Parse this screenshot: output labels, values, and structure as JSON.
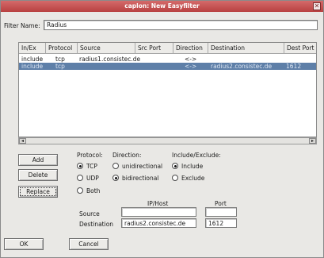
{
  "window": {
    "title": "caplon: New Easyfilter",
    "close_glyph": "✕"
  },
  "filter": {
    "label": "Filter Name:",
    "value": "Radius"
  },
  "table": {
    "headers": [
      "In/Ex",
      "Protocol",
      "Source",
      "Src Port",
      "Direction",
      "Destination",
      "Dest Port"
    ],
    "rows": [
      {
        "inex": "include",
        "protocol": "tcp",
        "source": "radius1.consistec.de",
        "src_port": "",
        "direction": "<->",
        "destination": "",
        "dest_port": ""
      },
      {
        "inex": "include",
        "protocol": "tcp",
        "source": "",
        "src_port": "",
        "direction": "<->",
        "destination": "radius2.consistec.de",
        "dest_port": "1612"
      }
    ],
    "selected_row": 1
  },
  "buttons": {
    "add": "Add",
    "delete": "Delete",
    "replace": "Replace",
    "ok": "OK",
    "cancel": "Cancel"
  },
  "protocol": {
    "label": "Protocol:",
    "options": [
      "TCP",
      "UDP",
      "Both"
    ],
    "selected": "TCP"
  },
  "direction": {
    "label": "Direction:",
    "options": [
      "unidirectional",
      "bidirectional"
    ],
    "selected": "bidirectional"
  },
  "include_exclude": {
    "label": "Include/Exclude:",
    "options": [
      "Include",
      "Exclude"
    ],
    "selected": "Include"
  },
  "address": {
    "ip_host_label": "IP/Host",
    "port_label": "Port",
    "source_label": "Source",
    "destination_label": "Destination",
    "source_host": "",
    "source_port": "",
    "destination_host": "radius2.consistec.de",
    "destination_port": "1612"
  },
  "colors": {
    "titlebar": "#b84040",
    "selection": "#5e7fa8",
    "window_bg": "#e9e8e5"
  }
}
